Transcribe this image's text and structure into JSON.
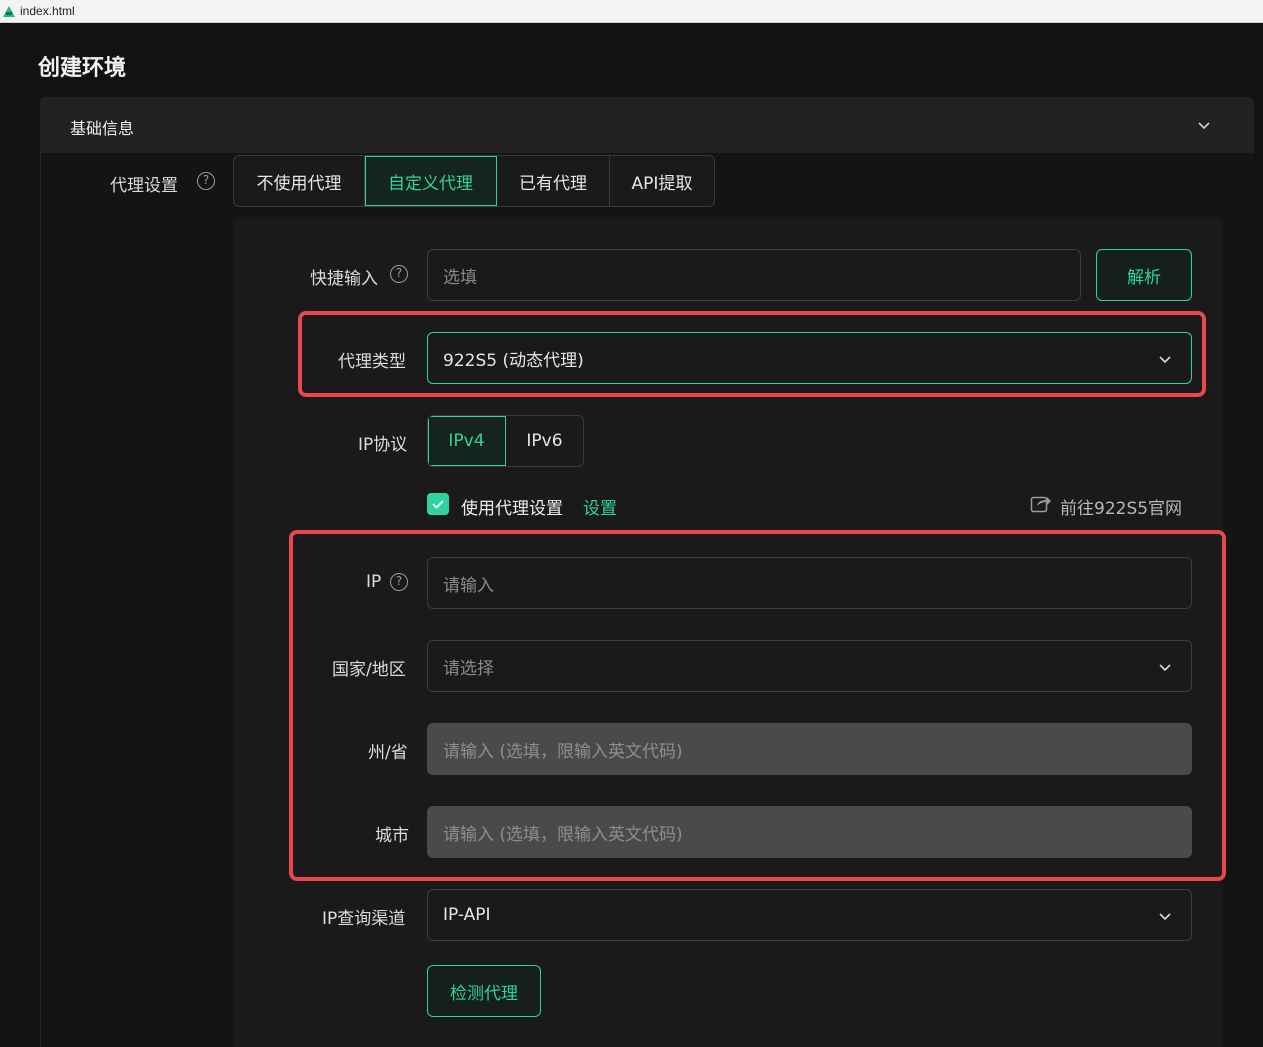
{
  "browser": {
    "tab_title": "index.html"
  },
  "page": {
    "title": "创建环境"
  },
  "section": {
    "title": "基础信息"
  },
  "proxy_settings": {
    "label": "代理设置",
    "modes": [
      "不使用代理",
      "自定义代理",
      "已有代理",
      "API提取"
    ],
    "active_mode": "自定义代理"
  },
  "quick_input": {
    "label": "快捷输入",
    "placeholder": "选填",
    "parse_button": "解析"
  },
  "proxy_type": {
    "label": "代理类型",
    "value": "922S5 (动态代理)"
  },
  "ip_protocol": {
    "label": "IP协议",
    "options": [
      "IPv4",
      "IPv6"
    ],
    "active": "IPv4"
  },
  "use_proxy_settings": {
    "checked": true,
    "label": "使用代理设置",
    "link": "设置",
    "official_site": "前往922S5官网"
  },
  "ip_field": {
    "label": "IP",
    "placeholder": "请输入"
  },
  "country": {
    "label": "国家/地区",
    "placeholder": "请选择"
  },
  "state": {
    "label": "州/省",
    "placeholder": "请输入 (选填，限输入英文代码)"
  },
  "city": {
    "label": "城市",
    "placeholder": "请输入 (选填，限输入英文代码)"
  },
  "ip_lookup": {
    "label": "IP查询渠道",
    "value": "IP-API"
  },
  "check_proxy": {
    "label": "检测代理"
  },
  "colors": {
    "accent": "#2ed3a0",
    "highlight": "#e8484c",
    "background": "#121212"
  }
}
